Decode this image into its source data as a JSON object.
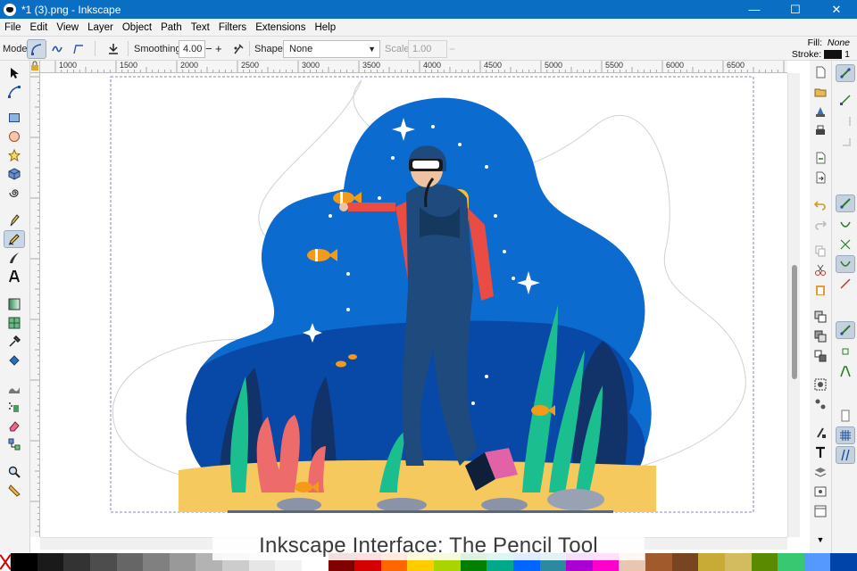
{
  "window": {
    "title": "*1 (3).png - Inkscape",
    "minimize_icon": "minimize-icon",
    "maximize_icon": "maximize-icon",
    "close_icon": "close-icon"
  },
  "menu": [
    "File",
    "Edit",
    "View",
    "Layer",
    "Object",
    "Path",
    "Text",
    "Filters",
    "Extensions",
    "Help"
  ],
  "tool_controls": {
    "mode_label": "Mode:",
    "smoothing_label": "Smoothing:",
    "smoothing_value": "4.00",
    "minus": "−",
    "plus": "+",
    "shape_label": "Shape:",
    "shape_value": "None",
    "scale_label": "Scale:",
    "scale_value": "1.00"
  },
  "style_indicator": {
    "fill_label": "Fill:",
    "fill_value": "None",
    "stroke_label": "Stroke:",
    "stroke_width": "1",
    "stroke_color": "#111111"
  },
  "ruler": {
    "top_labels": [
      "1000",
      "1500",
      "2000",
      "2500",
      "3000",
      "3500",
      "4000",
      "4500",
      "5000",
      "5500",
      "6000",
      "6500"
    ]
  },
  "tools": [
    "selector-icon",
    "node-icon",
    "rect-icon",
    "ellipse-icon",
    "star-icon",
    "box3d-icon",
    "spiral-icon",
    "pen-icon",
    "pencil-icon",
    "calligraphy-icon",
    "text-icon",
    "gradient-icon",
    "mesh-icon",
    "dropper-icon",
    "paint-bucket-icon",
    "tweak-icon",
    "spray-icon",
    "eraser-icon",
    "connector-icon",
    "zoom-icon",
    "measure-icon"
  ],
  "palette_colors": [
    "#000000",
    "#1a1a1a",
    "#333333",
    "#4d4d4d",
    "#666666",
    "#808080",
    "#999999",
    "#b3b3b3",
    "#cccccc",
    "#e6e6e6",
    "#f2f2f2",
    "#ffffff",
    "#800000",
    "#d40000",
    "#ff6600",
    "#ffcc00",
    "#aad400",
    "#008000",
    "#00aa88",
    "#0066ff",
    "#2c89a0",
    "#aa00d4",
    "#ff00cc",
    "#e9c6af",
    "#a05a2c",
    "#784421",
    "#c8ab37",
    "#d3bc5f",
    "#5a8a00",
    "#37c871",
    "#5599ff",
    "#0044aa"
  ],
  "caption": "Inkscape Interface: The Pencil Tool"
}
